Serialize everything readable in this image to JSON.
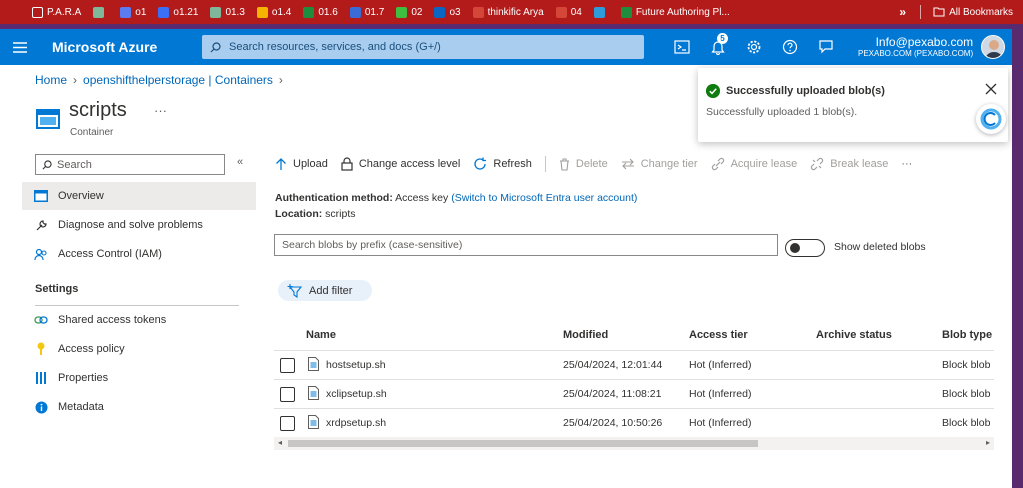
{
  "bookmarks": [
    {
      "label": "P.A.R.A",
      "color": "#ffffff",
      "icon": "folder-icon"
    },
    {
      "label": "",
      "color": "#7fb79a",
      "icon": "chatgpt-icon"
    },
    {
      "label": "o1",
      "color": "#5b7cf0",
      "icon": "shield-icon"
    },
    {
      "label": "o1.21",
      "color": "#3b6ff5",
      "icon": "meta-icon"
    },
    {
      "label": "01.3",
      "color": "#7fb79a",
      "icon": "chatgpt-icon"
    },
    {
      "label": "o1.4",
      "color": "#f4b400",
      "icon": "drive-icon"
    },
    {
      "label": "01.6",
      "color": "#1e8e3e",
      "icon": "sheets-icon"
    },
    {
      "label": "01.7",
      "color": "#3a6bd6",
      "icon": "wordpress-icon"
    },
    {
      "label": "02",
      "color": "#3fbf3f",
      "icon": "vp-icon"
    },
    {
      "label": "o3",
      "color": "#0a66c2",
      "icon": "linkedin-icon"
    },
    {
      "label": "thinkific Arya",
      "color": "#d44638",
      "icon": "gmail-icon"
    },
    {
      "label": "04",
      "color": "#d44638",
      "icon": "gmail-icon"
    },
    {
      "label": "",
      "color": "#2d9cdb",
      "icon": "vercel-icon"
    },
    {
      "label": "Future Authoring Pl...",
      "color": "#1e8e3e",
      "icon": "sheets-icon"
    }
  ],
  "bookmarks_more": "»",
  "all_bookmarks": "All Bookmarks",
  "header": {
    "brand": "Microsoft Azure",
    "search_placeholder": "Search resources, services, and docs (G+/)",
    "notifications_count": "5",
    "account_email": "Info@pexabo.com",
    "account_org": "PEXABO.COM (PEXABO.COM)"
  },
  "breadcrumb": {
    "home": "Home",
    "storage": "openshifthelperstorage | Containers"
  },
  "resource": {
    "title": "scripts",
    "subtitle": "Container",
    "more": "···"
  },
  "nav": {
    "search_placeholder": "Search",
    "collapse": "«",
    "items": [
      {
        "label": "Overview",
        "icon": "container-icon"
      },
      {
        "label": "Diagnose and solve problems",
        "icon": "wrench-icon"
      },
      {
        "label": "Access Control (IAM)",
        "icon": "people-icon"
      }
    ],
    "settings_title": "Settings",
    "settings_items": [
      {
        "label": "Shared access tokens",
        "icon": "link-icon"
      },
      {
        "label": "Access policy",
        "icon": "key-icon"
      },
      {
        "label": "Properties",
        "icon": "properties-icon"
      },
      {
        "label": "Metadata",
        "icon": "info-icon"
      }
    ]
  },
  "toolbar": {
    "upload": "Upload",
    "change_access_level": "Change access level",
    "refresh": "Refresh",
    "delete": "Delete",
    "change_tier": "Change tier",
    "acquire_lease": "Acquire lease",
    "break_lease": "Break lease",
    "more": "···"
  },
  "auth": {
    "label": "Authentication method:",
    "value": "Access key",
    "switch_link": "(Switch to Microsoft Entra user account)",
    "location_label": "Location:",
    "location_value": "scripts"
  },
  "blob_search_placeholder": "Search blobs by prefix (case-sensitive)",
  "show_deleted_label": "Show deleted blobs",
  "add_filter": "Add filter",
  "table": {
    "headers": [
      "Name",
      "Modified",
      "Access tier",
      "Archive status",
      "Blob type"
    ],
    "rows": [
      {
        "name": "hostsetup.sh",
        "modified": "25/04/2024, 12:01:44",
        "tier": "Hot (Inferred)",
        "archive": "",
        "type": "Block blob"
      },
      {
        "name": "xclipsetup.sh",
        "modified": "25/04/2024, 11:08:21",
        "tier": "Hot (Inferred)",
        "archive": "",
        "type": "Block blob"
      },
      {
        "name": "xrdpsetup.sh",
        "modified": "25/04/2024, 10:50:26",
        "tier": "Hot (Inferred)",
        "archive": "",
        "type": "Block blob"
      }
    ]
  },
  "toast": {
    "title": "Successfully uploaded blob(s)",
    "body": "Successfully uploaded 1 blob(s)."
  }
}
